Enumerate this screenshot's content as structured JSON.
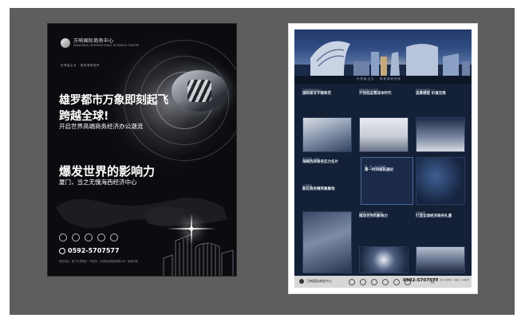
{
  "left_poster": {
    "logo_name": "万响国际商务中心",
    "logo_subtitle": "WANXIANG INTERNATIONAL BUSINESS CENTER",
    "tagline": "世界级企业 · 雄视海峡西岸",
    "headline_line1": "雄罗都市万象即刻起飞",
    "headline_line2": "跨越全球!",
    "headline_sub": "开启世界高端商务经济办公潮流",
    "headline2": "爆发世界的影响力",
    "headline2_sub": "厦门，当之无愧海西经济中心",
    "phone": "0592-5707577",
    "address": "项目地址：厦门市思明区 · 开发商：万响投资集团有限公司 · 营销代理"
  },
  "right_poster": {
    "strip_text": "世界级企业 · 雄视海峡西岸",
    "col1_caption": "万响国际商务中心",
    "col1_title": "国际级写字楼典范",
    "col2_caption": "高端商务交往空间",
    "col2_title": "开创低运营成本时代",
    "col3_caption": "世界商务精英人士",
    "col3_title": "追景楼座 价值无限",
    "row2_caption1": "区位优势 · CBD",
    "row2_title1": "海峡西岸商务实力名片",
    "row2_caption2": "交通便捷",
    "row2_title2": "新区商务精英聚集地",
    "row2_caption_mid": "居、商、交之合构建",
    "row2_title_mid": "第一时间城轨通达",
    "row3_caption1": "全面建设中 · 品质呈现",
    "row3_title1": "推动世界的影响力",
    "row3_caption2": "全球视野",
    "row3_title2": "打造全球经济商务礼遇",
    "footer_logo": "万响国际商务中心",
    "footer_phone": "0592-5707577",
    "footer_address": "项目地址：厦门市思明区 · 开发商：万响投资集团"
  },
  "colors": {
    "canvas": "#5f5e5e",
    "left_poster_bg": "#0b0c0f",
    "right_poster_bg": "#142036",
    "footer": "#d7d7d7"
  }
}
